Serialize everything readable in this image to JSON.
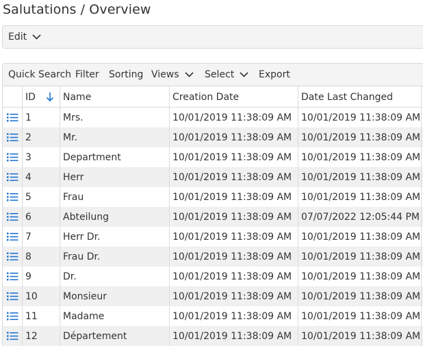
{
  "page": {
    "title": "Salutations / Overview"
  },
  "edit_bar": {
    "edit_label": "Edit"
  },
  "toolbar": {
    "quick_search": "Quick Search",
    "filter": "Filter",
    "sorting": "Sorting",
    "views": "Views",
    "select": "Select",
    "export": "Export"
  },
  "grid": {
    "columns": {
      "id": "ID",
      "name": "Name",
      "creation_date": "Creation Date",
      "date_last_changed": "Date Last Changed"
    },
    "sort": {
      "column": "ID",
      "direction": "descending-arrow"
    },
    "rows": [
      {
        "id": "1",
        "name": "Mrs.",
        "created": "10/01/2019 11:38:09 AM",
        "changed": "10/01/2019 11:38:09 AM"
      },
      {
        "id": "2",
        "name": "Mr.",
        "created": "10/01/2019 11:38:09 AM",
        "changed": "10/01/2019 11:38:09 AM"
      },
      {
        "id": "3",
        "name": "Department",
        "created": "10/01/2019 11:38:09 AM",
        "changed": "10/01/2019 11:38:09 AM"
      },
      {
        "id": "4",
        "name": "Herr",
        "created": "10/01/2019 11:38:09 AM",
        "changed": "10/01/2019 11:38:09 AM"
      },
      {
        "id": "5",
        "name": "Frau",
        "created": "10/01/2019 11:38:09 AM",
        "changed": "10/01/2019 11:38:09 AM"
      },
      {
        "id": "6",
        "name": "Abteilung",
        "created": "10/01/2019 11:38:09 AM",
        "changed": "07/07/2022 12:05:44 PM"
      },
      {
        "id": "7",
        "name": "Herr Dr.",
        "created": "10/01/2019 11:38:09 AM",
        "changed": "10/01/2019 11:38:09 AM"
      },
      {
        "id": "8",
        "name": "Frau Dr.",
        "created": "10/01/2019 11:38:09 AM",
        "changed": "10/01/2019 11:38:09 AM"
      },
      {
        "id": "9",
        "name": "Dr.",
        "created": "10/01/2019 11:38:09 AM",
        "changed": "10/01/2019 11:38:09 AM"
      },
      {
        "id": "10",
        "name": "Monsieur",
        "created": "10/01/2019 11:38:09 AM",
        "changed": "10/01/2019 11:38:09 AM"
      },
      {
        "id": "11",
        "name": "Madame",
        "created": "10/01/2019 11:38:09 AM",
        "changed": "10/01/2019 11:38:09 AM"
      },
      {
        "id": "12",
        "name": "Département",
        "created": "10/01/2019 11:38:09 AM",
        "changed": "10/01/2019 11:38:09 AM"
      }
    ]
  },
  "colors": {
    "accent": "#1e74d2",
    "row_alt": "#f0f0f0",
    "bar_bg": "#f4f4f4",
    "border": "#d8d8d8"
  },
  "icons": {
    "row_open": "list-icon",
    "sort": "arrow-down-icon",
    "dropdown": "chevron-down-icon"
  }
}
